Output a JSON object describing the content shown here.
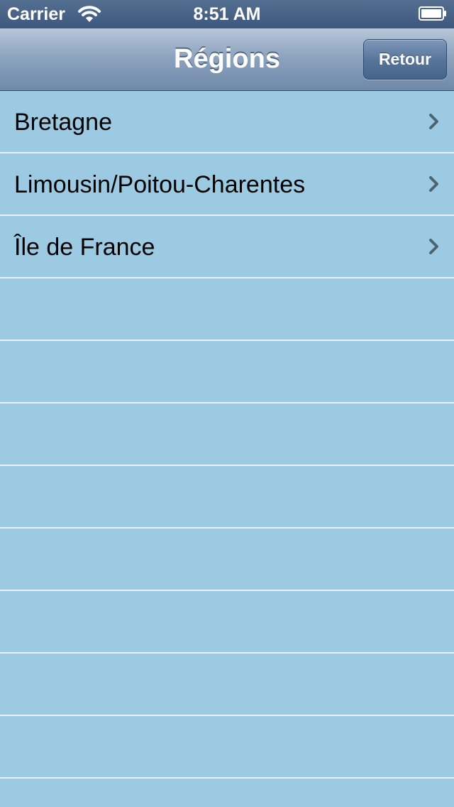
{
  "status_bar": {
    "carrier": "Carrier",
    "time": "8:51 AM",
    "wifi_icon": "wifi-icon",
    "battery_icon": "battery-icon"
  },
  "nav_bar": {
    "title": "Régions",
    "right_button_label": "Retour"
  },
  "table": {
    "rows": [
      {
        "label": "Bretagne",
        "accessory": "chevron-right-icon"
      },
      {
        "label": "Limousin/Poitou-Charentes",
        "accessory": "chevron-right-icon"
      },
      {
        "label": "Île de France",
        "accessory": "chevron-right-icon"
      }
    ],
    "empty_rows": 9
  },
  "colors": {
    "table_background": "#9ccae2",
    "separator": "#e8f2f8",
    "chevron": "#4f6272",
    "nav_bar_tint": "#6f89a9"
  }
}
